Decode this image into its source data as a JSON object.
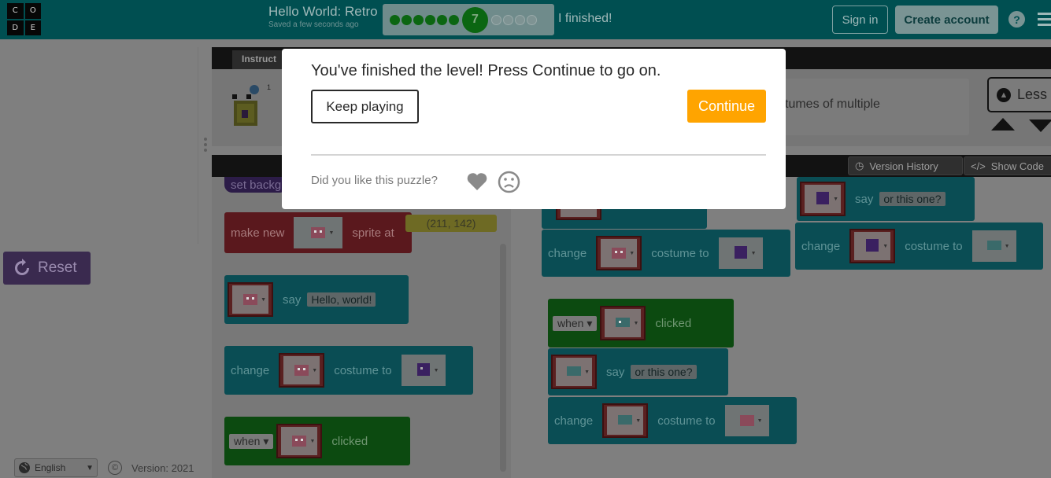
{
  "header": {
    "logo_letters": [
      "C",
      "O",
      "D",
      "E"
    ],
    "project_title": "Hello World: Retro",
    "saved_status": "Saved a few seconds ago",
    "progress": {
      "completed_dots": 6,
      "current_level": "7",
      "remaining_dots": 4
    },
    "finished_label": "I finished!",
    "sign_in": "Sign in",
    "create_account": "Create account",
    "help": "?"
  },
  "left": {
    "reset_label": "Reset",
    "language": "English",
    "copyright_symbol": "©",
    "version": "Version: 2021"
  },
  "instructions": {
    "tab_label": "Instruct",
    "badge": "1",
    "text": "tumes of multiple",
    "less_label": "Less"
  },
  "workspace_header": {
    "version_history": "Version History",
    "show_code": "Show Code"
  },
  "toolbox": {
    "set_background": "set backg",
    "make_new": "make new",
    "sprite_at": "sprite at",
    "coords": "(211, 142)",
    "say": "say",
    "hello_world": "Hello, world!",
    "change": "change",
    "costume_to": "costume to",
    "when": "when",
    "clicked": "clicked"
  },
  "workspace": {
    "say": "say",
    "or_this_one": "or this one?",
    "change": "change",
    "costume_to": "costume to",
    "when": "when",
    "clicked": "clicked"
  },
  "modal": {
    "title": "You've finished the level! Press Continue to go on.",
    "keep_playing": "Keep playing",
    "continue": "Continue",
    "feedback_prompt": "Did you like this puzzle?"
  },
  "colors": {
    "header_bg": "#004f51",
    "continue_orange": "#ffa400",
    "modal_bg": "#ffffff"
  }
}
